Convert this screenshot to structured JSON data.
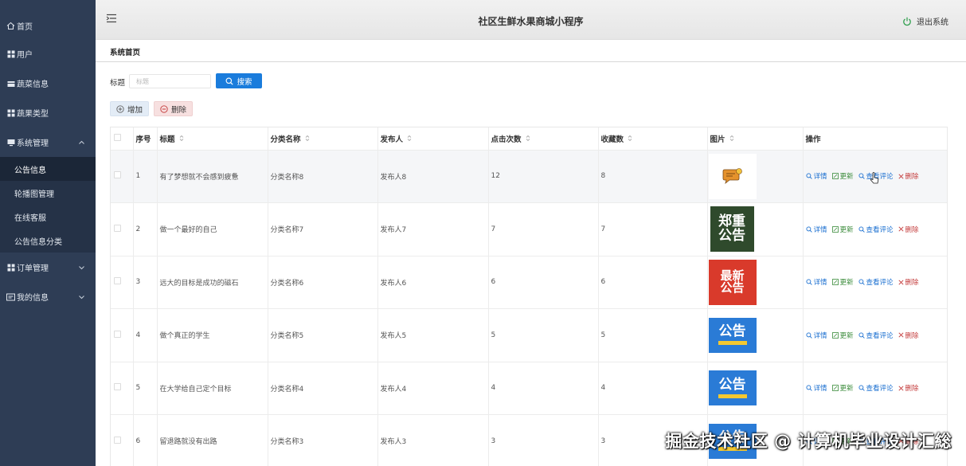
{
  "sidebar": {
    "items": [
      {
        "label": "首页",
        "icon": "home-icon"
      },
      {
        "label": "用户",
        "icon": "grid-icon"
      },
      {
        "label": "蔬菜信息",
        "icon": "list-icon"
      },
      {
        "label": "蔬果类型",
        "icon": "grid-icon"
      },
      {
        "label": "系统管理",
        "icon": "monitor-icon",
        "expanded": true
      },
      {
        "label": "订单管理",
        "icon": "grid-icon",
        "expanded": false
      },
      {
        "label": "我的信息",
        "icon": "id-card-icon",
        "expanded": false
      }
    ],
    "subitems": [
      {
        "label": "公告信息",
        "active": true
      },
      {
        "label": "轮播图管理"
      },
      {
        "label": "在线客服"
      },
      {
        "label": "公告信息分类"
      }
    ]
  },
  "header": {
    "title": "社区生鲜水果商城小程序",
    "logout_label": "退出系统"
  },
  "breadcrumb": "系统首页",
  "search": {
    "label": "标题",
    "placeholder": "标题",
    "button_label": "搜索"
  },
  "actions": {
    "add_label": "增加",
    "delete_label": "删除"
  },
  "table": {
    "columns": [
      "序号",
      "标题",
      "分类名称",
      "发布人",
      "点击次数",
      "收藏数",
      "图片",
      "操作"
    ],
    "rows": [
      {
        "index": "1",
        "title": "有了梦想就不会感到疲惫",
        "category": "分类名称8",
        "publisher": "发布人8",
        "clicks": "12",
        "favorites": "8",
        "image": "speech-bubble-icon"
      },
      {
        "index": "2",
        "title": "做一个最好的自己",
        "category": "分类名称7",
        "publisher": "发布人7",
        "clicks": "7",
        "favorites": "7",
        "image": "郑重公告"
      },
      {
        "index": "3",
        "title": "远大的目标是成功的磁石",
        "category": "分类名称6",
        "publisher": "发布人6",
        "clicks": "6",
        "favorites": "6",
        "image": "最新公告"
      },
      {
        "index": "4",
        "title": "做个真正的学生",
        "category": "分类名称5",
        "publisher": "发布人5",
        "clicks": "5",
        "favorites": "5",
        "image": "公告"
      },
      {
        "index": "5",
        "title": "在大学给自己定个目标",
        "category": "分类名称4",
        "publisher": "发布人4",
        "clicks": "4",
        "favorites": "4",
        "image": "公告"
      },
      {
        "index": "6",
        "title": "留退路就没有出路",
        "category": "分类名称3",
        "publisher": "发布人3",
        "clicks": "3",
        "favorites": "3",
        "image": "公告"
      }
    ],
    "ops": {
      "detail": "详情",
      "update": "更新",
      "comments": "查看评论",
      "delete": "删除"
    }
  },
  "thumbs": {
    "t2_line1": "郑重",
    "t2_line2": "公告",
    "t3_line1": "最新",
    "t3_line2": "公告",
    "t4": "公告",
    "t5": "公告",
    "t6": "公告"
  },
  "watermark": "掘金技术社区 @ 计算机毕业设计汇総",
  "colors": {
    "sidebar_bg": "#2e3d55",
    "primary": "#1a7cdc",
    "danger": "#c43c3c"
  }
}
